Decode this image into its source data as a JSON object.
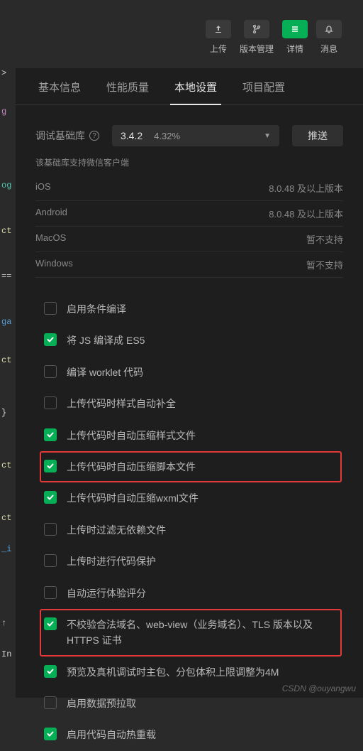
{
  "toolbar": {
    "upload": "上传",
    "version": "版本管理",
    "details": "详情",
    "notifications": "消息"
  },
  "tabs": [
    "基本信息",
    "性能质量",
    "本地设置",
    "项目配置"
  ],
  "active_tab": 2,
  "lib": {
    "label": "调试基础库",
    "version": "3.4.2",
    "percent": "4.32%",
    "push_btn": "推送",
    "note": "该基础库支持微信客户端",
    "rows": [
      {
        "os": "iOS",
        "val": "8.0.48 及以上版本"
      },
      {
        "os": "Android",
        "val": "8.0.48 及以上版本"
      },
      {
        "os": "MacOS",
        "val": "暂不支持"
      },
      {
        "os": "Windows",
        "val": "暂不支持"
      }
    ]
  },
  "checks": [
    {
      "label": "启用条件编译",
      "checked": false,
      "hl": false
    },
    {
      "label": "将 JS 编译成 ES5",
      "checked": true,
      "hl": false
    },
    {
      "label": "编译 worklet 代码",
      "checked": false,
      "hl": false
    },
    {
      "label": "上传代码时样式自动补全",
      "checked": false,
      "hl": false
    },
    {
      "label": "上传代码时自动压缩样式文件",
      "checked": true,
      "hl": false
    },
    {
      "label": "上传代码时自动压缩脚本文件",
      "checked": true,
      "hl": true
    },
    {
      "label": "上传代码时自动压缩wxml文件",
      "checked": true,
      "hl": false
    },
    {
      "label": "上传时过滤无依赖文件",
      "checked": false,
      "hl": false
    },
    {
      "label": "上传时进行代码保护",
      "checked": false,
      "hl": false
    },
    {
      "label": "自动运行体验评分",
      "checked": false,
      "hl": false
    },
    {
      "label": "不校验合法域名、web-view（业务域名）、TLS 版本以及 HTTPS 证书",
      "checked": true,
      "hl": true
    },
    {
      "label": "预览及真机调试时主包、分包体积上限调整为4M",
      "checked": true,
      "hl": false
    },
    {
      "label": "启用数据预拉取",
      "checked": false,
      "hl": false
    },
    {
      "label": "启用代码自动热重载",
      "checked": true,
      "hl": false
    }
  ],
  "watermark": "CSDN @ouyangwu",
  "gutter": [
    {
      "t": ">",
      "c": "c-white",
      "pad": 0
    },
    {
      "t": "g",
      "c": "c-purple",
      "pad": 40
    },
    {
      "t": "",
      "c": "",
      "pad": 40
    },
    {
      "t": "og",
      "c": "c-green",
      "pad": 90
    },
    {
      "t": "",
      "c": "",
      "pad": 20
    },
    {
      "t": "ct",
      "c": "c-yellow",
      "pad": 50
    },
    {
      "t": "==",
      "c": "c-white",
      "pad": 50
    },
    {
      "t": "ga",
      "c": "c-blue",
      "pad": 50
    },
    {
      "t": "ct",
      "c": "c-yellow",
      "pad": 40
    },
    {
      "t": "}",
      "c": "c-white",
      "pad": 60
    },
    {
      "t": "",
      "c": "",
      "pad": 40
    },
    {
      "t": "",
      "c": "",
      "pad": 50
    },
    {
      "t": "ct",
      "c": "c-yellow",
      "pad": 60
    },
    {
      "t": "",
      "c": "",
      "pad": 50
    },
    {
      "t": "",
      "c": "",
      "pad": 50
    },
    {
      "t": "ct",
      "c": "c-yellow",
      "pad": 60
    },
    {
      "t": "_i",
      "c": "c-blue",
      "pad": 30
    },
    {
      "t": "",
      "c": "",
      "pad": 50
    },
    {
      "t": "",
      "c": "",
      "pad": 90
    },
    {
      "t": "↑",
      "c": "c-white",
      "pad": 20
    },
    {
      "t": "",
      "c": "",
      "pad": 30
    },
    {
      "t": "In",
      "c": "c-white",
      "pad": 20
    }
  ]
}
